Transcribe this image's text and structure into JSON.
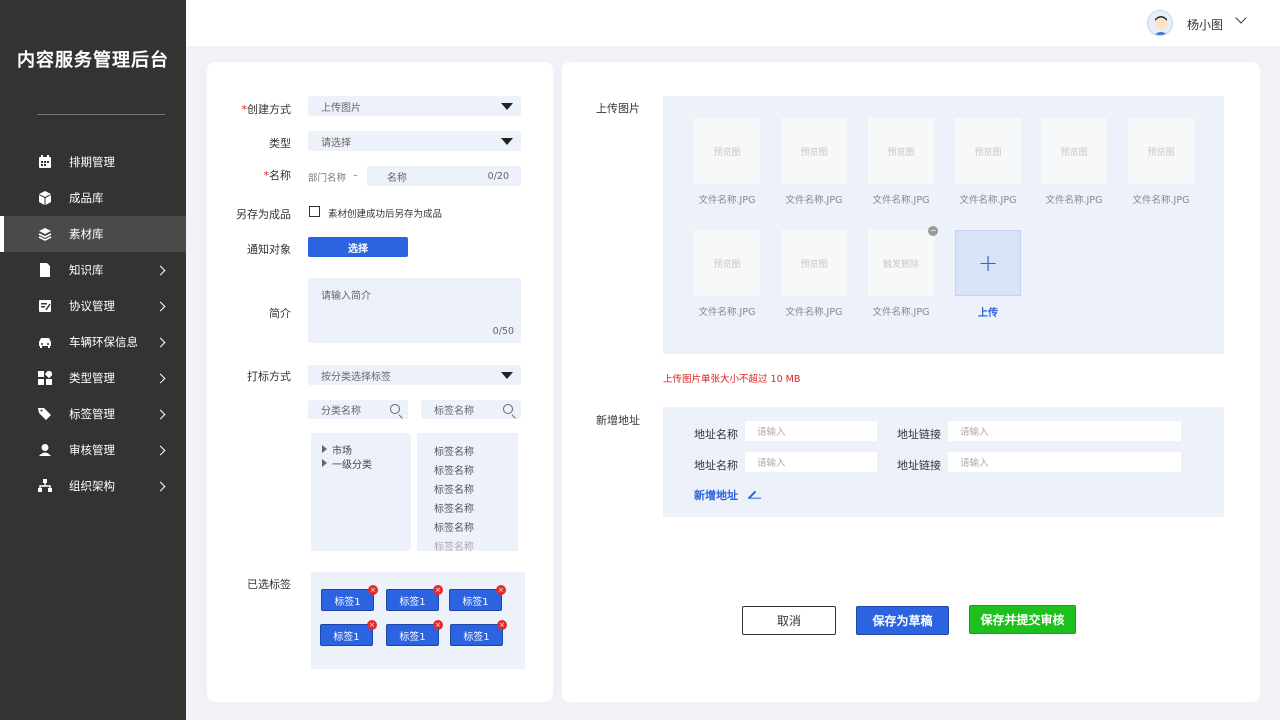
{
  "app": {
    "title": "内容服务管理后台"
  },
  "sidebar": {
    "items": [
      {
        "label": "排期管理",
        "icon": "calendar-icon",
        "arrow": false
      },
      {
        "label": "成品库",
        "icon": "cube-icon",
        "arrow": false
      },
      {
        "label": "素材库",
        "icon": "layers-icon",
        "arrow": false,
        "active": true
      },
      {
        "label": "知识库",
        "icon": "document-icon",
        "arrow": true
      },
      {
        "label": "协议管理",
        "icon": "edit-doc-icon",
        "arrow": true
      },
      {
        "label": "车辆环保信息",
        "icon": "car-icon",
        "arrow": true
      },
      {
        "label": "类型管理",
        "icon": "grid-icon",
        "arrow": true
      },
      {
        "label": "标签管理",
        "icon": "tag-icon",
        "arrow": true
      },
      {
        "label": "审核管理",
        "icon": "user-icon",
        "arrow": true
      },
      {
        "label": "组织架构",
        "icon": "org-chart-icon",
        "arrow": true
      }
    ]
  },
  "header": {
    "user_name": "杨小图"
  },
  "form": {
    "create_method": {
      "label": "创建方式",
      "value": "上传图片"
    },
    "type": {
      "label": "类型",
      "placeholder": "请选择"
    },
    "name": {
      "label": "名称",
      "dept_placeholder": "部门名称",
      "separator": "–",
      "name_placeholder": "名称",
      "counter": "0/20"
    },
    "save_as": {
      "label": "另存为成品",
      "checkbox_text": "素材创建成功后另存为成品"
    },
    "notify": {
      "label": "通知对象",
      "button": "选择"
    },
    "intro": {
      "label": "简介",
      "placeholder": "请输入简介",
      "counter": "0/50"
    },
    "tagging": {
      "label": "打标方式",
      "value": "按分类选择标签",
      "category_search": "分类名称",
      "tag_search": "标签名称"
    },
    "tree": [
      "市场",
      "一级分类"
    ],
    "tag_list": [
      "标签名称",
      "标签名称",
      "标签名称",
      "标签名称",
      "标签名称",
      "标签名称"
    ],
    "selected": {
      "label": "已选标签",
      "chips": [
        "标签1",
        "标签1",
        "标签1",
        "标签1",
        "标签1",
        "标签1"
      ],
      "remove_symbol": "×"
    }
  },
  "upload": {
    "label": "上传图片",
    "images": [
      {
        "preview": "预览图",
        "name": "文件名称.JPG"
      },
      {
        "preview": "预览图",
        "name": "文件名称.JPG"
      },
      {
        "preview": "预览图",
        "name": "文件名称.JPG"
      },
      {
        "preview": "预览图",
        "name": "文件名称.JPG"
      },
      {
        "preview": "预览图",
        "name": "文件名称.JPG"
      },
      {
        "preview": "预览图",
        "name": "文件名称.JPG"
      },
      {
        "preview": "预览图",
        "name": "文件名称.JPG"
      },
      {
        "preview": "预览图",
        "name": "文件名称.JPG"
      },
      {
        "preview": "触发删除",
        "name": "文件名称.JPG"
      }
    ],
    "upload_button": "上传",
    "plus_symbol": "+",
    "remove_symbol": "−",
    "tip": "上传图片单张大小不超过 10 MB"
  },
  "address": {
    "label": "新增地址",
    "rows": [
      {
        "name_label": "地址名称",
        "name_placeholder": "请输入",
        "link_label": "地址链接",
        "link_placeholder": "请输入"
      },
      {
        "name_label": "地址名称",
        "name_placeholder": "请输入",
        "link_label": "地址链接",
        "link_placeholder": "请输入"
      }
    ],
    "add_link": "新增地址"
  },
  "actions": {
    "cancel": "取消",
    "save_draft": "保存为草稿",
    "save_submit": "保存并提交审核"
  },
  "colors": {
    "primary": "#2b63e0",
    "success": "#1ec01e",
    "danger": "#e02020",
    "sidebar": "#333333"
  }
}
